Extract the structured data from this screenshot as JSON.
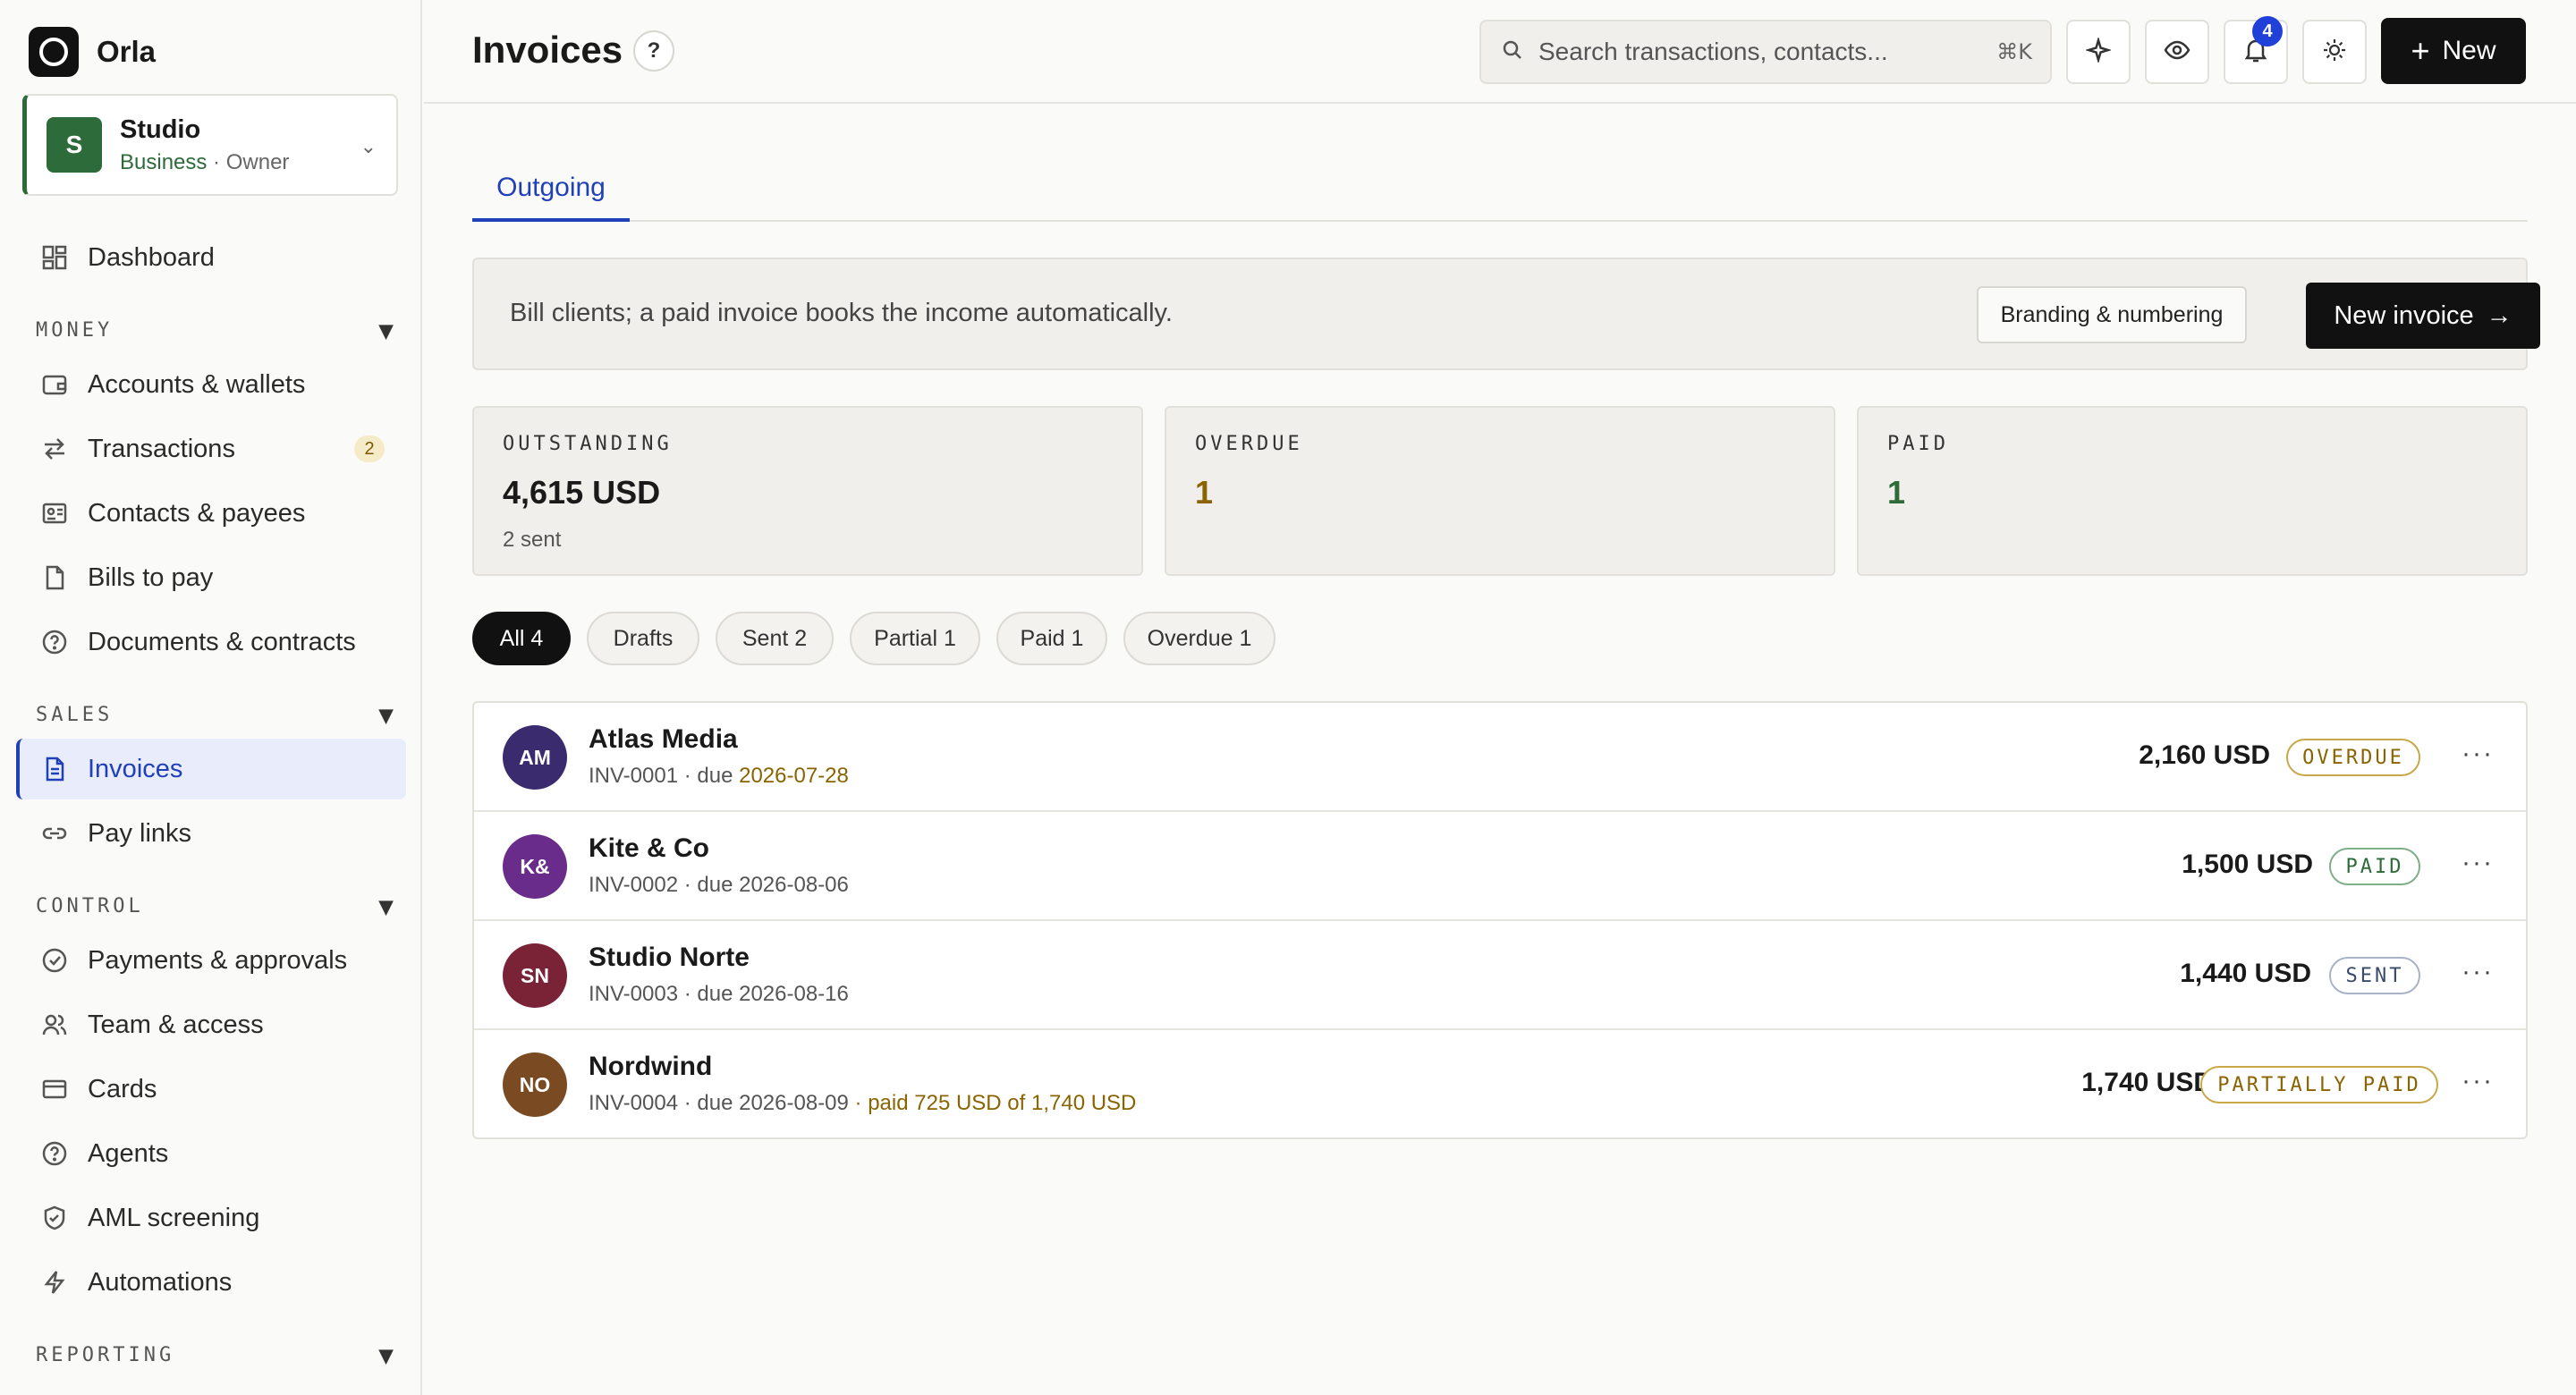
{
  "brand": {
    "name": "Orla"
  },
  "org": {
    "avatar": "S",
    "name": "Studio",
    "plan": "Business",
    "role": " · Owner"
  },
  "nav": {
    "dashboard": "Dashboard",
    "sections": {
      "money": "MONEY",
      "sales": "SALES",
      "control": "CONTROL",
      "reporting": "REPORTING"
    },
    "accounts": "Accounts & wallets",
    "transactions": "Transactions",
    "transactions_badge": "2",
    "contacts": "Contacts & payees",
    "bills": "Bills to pay",
    "documents": "Documents & contracts",
    "invoices": "Invoices",
    "paylinks": "Pay links",
    "payments": "Payments & approvals",
    "team": "Team & access",
    "cards": "Cards",
    "agents": "Agents",
    "aml": "AML screening",
    "automations": "Automations"
  },
  "header": {
    "title": "Invoices",
    "help": "?",
    "search_placeholder": "Search transactions, contacts...",
    "search_shortcut": "⌘K",
    "notifications_count": "4",
    "new_label": "New"
  },
  "tabs": {
    "outgoing": "Outgoing"
  },
  "banner": {
    "text": "Bill clients; a paid invoice books the income automatically.",
    "branding_label": "Branding & numbering",
    "new_invoice_label": "New invoice",
    "arrow": "→"
  },
  "stats": {
    "outstanding": {
      "label": "OUTSTANDING",
      "value": "4,615 USD",
      "sub": "2 sent"
    },
    "overdue": {
      "label": "OVERDUE",
      "value": "1"
    },
    "paid": {
      "label": "PAID",
      "value": "1"
    }
  },
  "filters": {
    "all": "All 4",
    "drafts": "Drafts",
    "sent": "Sent 2",
    "partial": "Partial 1",
    "paid": "Paid 1",
    "overdue": "Overdue 1"
  },
  "invoices": [
    {
      "initials": "AM",
      "name": "Atlas Media",
      "number": "INV-0001 · due ",
      "due": "2026-07-28",
      "amount": "2,160 USD",
      "status": "OVERDUE",
      "color": "#3a2a6e"
    },
    {
      "initials": "K&",
      "name": "Kite & Co",
      "number": "INV-0002 · due ",
      "due": "2026-08-06",
      "amount": "1,500 USD",
      "status": "PAID",
      "color": "#6a2c8a"
    },
    {
      "initials": "SN",
      "name": "Studio Norte",
      "number": "INV-0003 · due ",
      "due": "2026-08-16",
      "amount": "1,440 USD",
      "status": "SENT",
      "color": "#7a2236"
    },
    {
      "initials": "NO",
      "name": "Nordwind",
      "number": "INV-0004 · due ",
      "due": "2026-08-09",
      "partial": " · paid 725 USD of 1,740 USD",
      "amount": "1,740 USD",
      "status": "PARTIALLY PAID",
      "color": "#7a4a22"
    }
  ],
  "more_label": "···",
  "colors": {
    "accent": "#2040b8",
    "brand_green": "#2e6b3a",
    "overdue": "#8a6400",
    "paid": "#2e6b3a",
    "sent": "#3a4a6a"
  }
}
